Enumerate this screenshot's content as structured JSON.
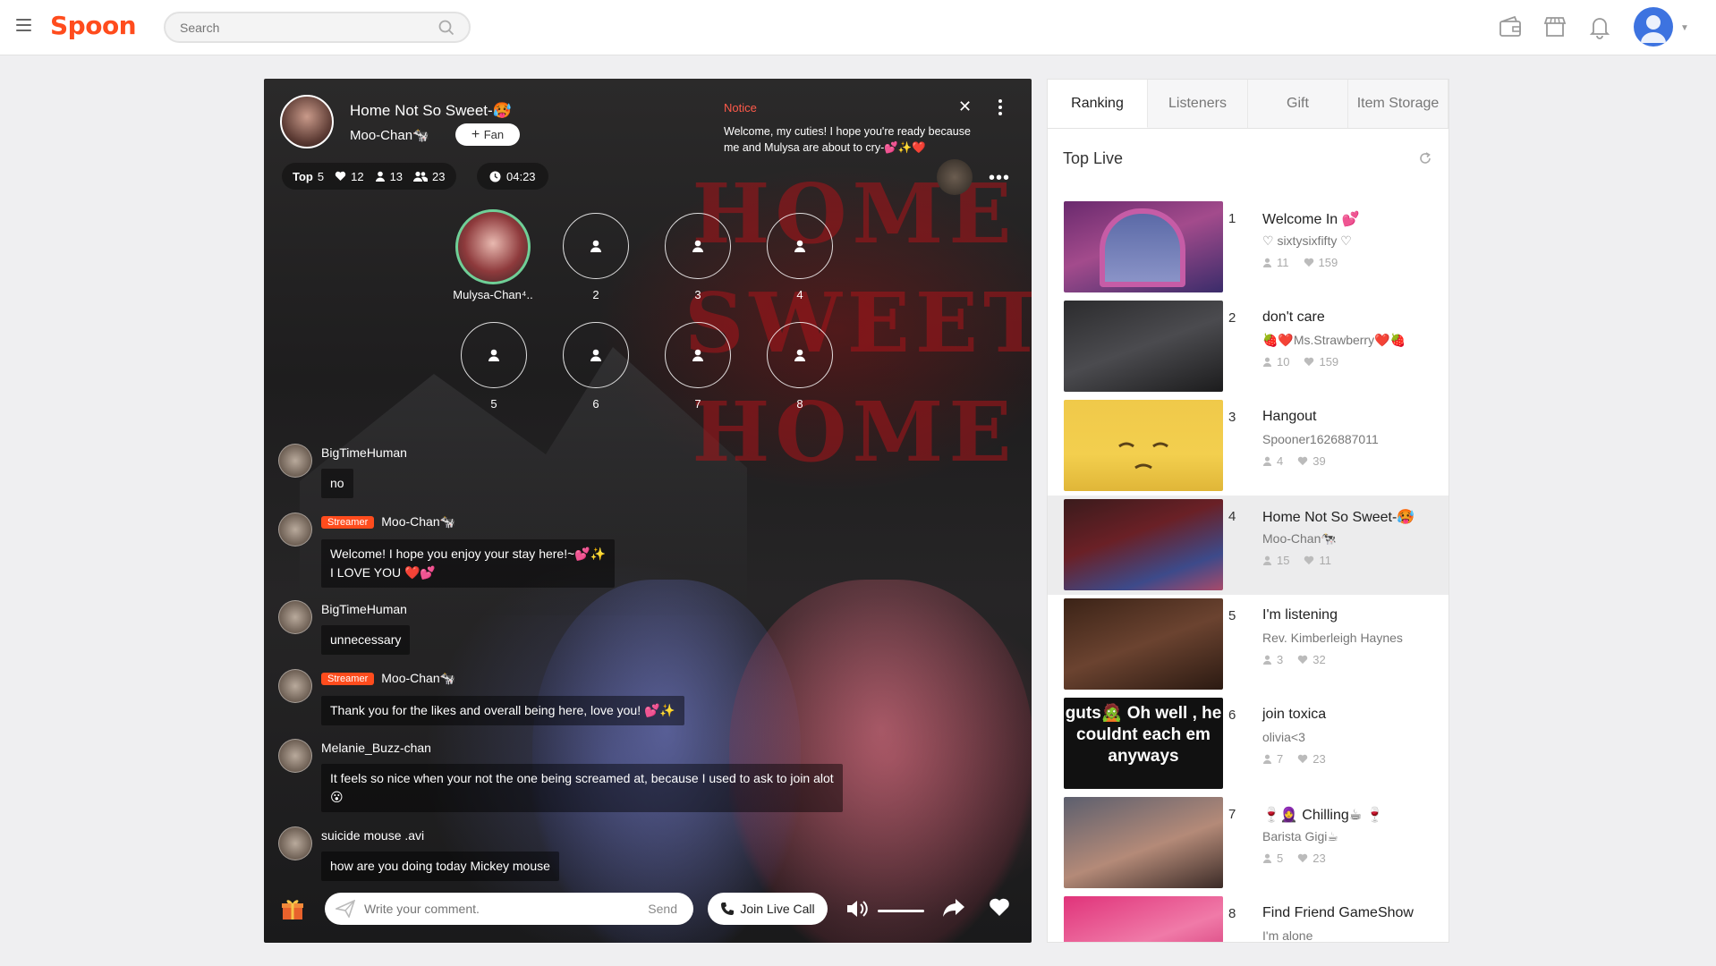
{
  "app": {
    "logo": "Spoon"
  },
  "search": {
    "placeholder": "Search"
  },
  "room": {
    "title": "Home Not So Sweet-🥵",
    "host": "Moo-Chan🐄",
    "fan_label": "Fan",
    "bg_text": "HOME SWEET HOME",
    "stats": {
      "top_label": "Top",
      "top_value": "5",
      "likes": "12",
      "listeners": "13",
      "total": "23",
      "timer": "04:23"
    },
    "notice": {
      "title": "Notice",
      "text": "Welcome, my cuties! I hope you're ready because me and Mulysa are about to cry-💕✨❤️"
    },
    "seats": [
      "Mulysa-Chan⁴..",
      "2",
      "3",
      "4",
      "5",
      "6",
      "7",
      "8"
    ],
    "chat": [
      {
        "name": "BigTimeHuman",
        "badge": "",
        "text": "no"
      },
      {
        "name": "Moo-Chan🐄",
        "badge": "Streamer",
        "text": "Welcome! I hope you enjoy your stay here!~💕✨",
        "text2": "I LOVE YOU ❤️💕"
      },
      {
        "name": "BigTimeHuman",
        "badge": "",
        "text": "unnecessary"
      },
      {
        "name": "Moo-Chan🐄",
        "badge": "Streamer",
        "text": "Thank you for the likes and overall being here, love you! 💕✨"
      },
      {
        "name": "Melanie_Buzz-chan",
        "badge": "",
        "text": "It feels so nice when your not the one being screamed at, because I used to ask to join alot",
        "text2": "😮"
      },
      {
        "name": "suicide mouse .avi",
        "badge": "",
        "text": "how are you doing today Mickey mouse"
      }
    ],
    "comment_placeholder": "Write your comment.",
    "send_label": "Send",
    "call_label": "Join Live Call"
  },
  "panel": {
    "tabs": [
      "Ranking",
      "Listeners",
      "Gift",
      "Item Storage"
    ],
    "title": "Top Live",
    "items": [
      {
        "rank": "1",
        "title": "Welcome In 💕",
        "host": "♡ sixtysixfifty ♡",
        "listeners": "11",
        "likes": "159",
        "thumb": "linear-gradient(160deg,#6a2a6e,#a34b8c 45%,#3a2c6a)"
      },
      {
        "rank": "2",
        "title": "don't care",
        "host": "🍓❤️Ms.Strawberry❤️🍓",
        "listeners": "10",
        "likes": "159",
        "thumb": "linear-gradient(160deg,#2c2c2e,#4b4b4f 50%,#1c1c1d)"
      },
      {
        "rank": "3",
        "title": "Hangout",
        "host": "Spooner1626887011",
        "listeners": "4",
        "likes": "39",
        "thumb": "linear-gradient(180deg,#f0c94a,#f3cf4e 60%,#e0b638)"
      },
      {
        "rank": "4",
        "title": "Home Not So Sweet-🥵",
        "host": "Moo-Chan🐄",
        "listeners": "15",
        "likes": "11",
        "thumb": "linear-gradient(160deg,#3a1b1c,#6a2026 40%,#3d4a8a 75%,#a84a6a)"
      },
      {
        "rank": "5",
        "title": "I'm listening",
        "host": "Rev. Kimberleigh Haynes",
        "listeners": "3",
        "likes": "32",
        "thumb": "linear-gradient(160deg,#3b2317,#6b4330 50%,#2b1a12)"
      },
      {
        "rank": "6",
        "title": "join toxica",
        "host": "olivia<3",
        "listeners": "7",
        "likes": "23",
        "thumb": "linear-gradient(160deg,#111,#262626 60%,#0d0d0d)"
      },
      {
        "rank": "7",
        "title": "🍷🧕 Chilling☕ 🍷",
        "host": "Barista Gigi☕",
        "listeners": "5",
        "likes": "23",
        "thumb": "linear-gradient(160deg,#5c5f6e,#b48a78 55%,#3b2b27)"
      },
      {
        "rank": "8",
        "title": "Find Friend GameShow",
        "host": "I'm alone",
        "listeners": "",
        "likes": "",
        "thumb": "linear-gradient(160deg,#e0337a,#f07aa8 50%,#c91f64)"
      }
    ],
    "thumb_captions": {
      "t6": "guts🧟 Oh well , he couldnt each em anyways"
    }
  }
}
